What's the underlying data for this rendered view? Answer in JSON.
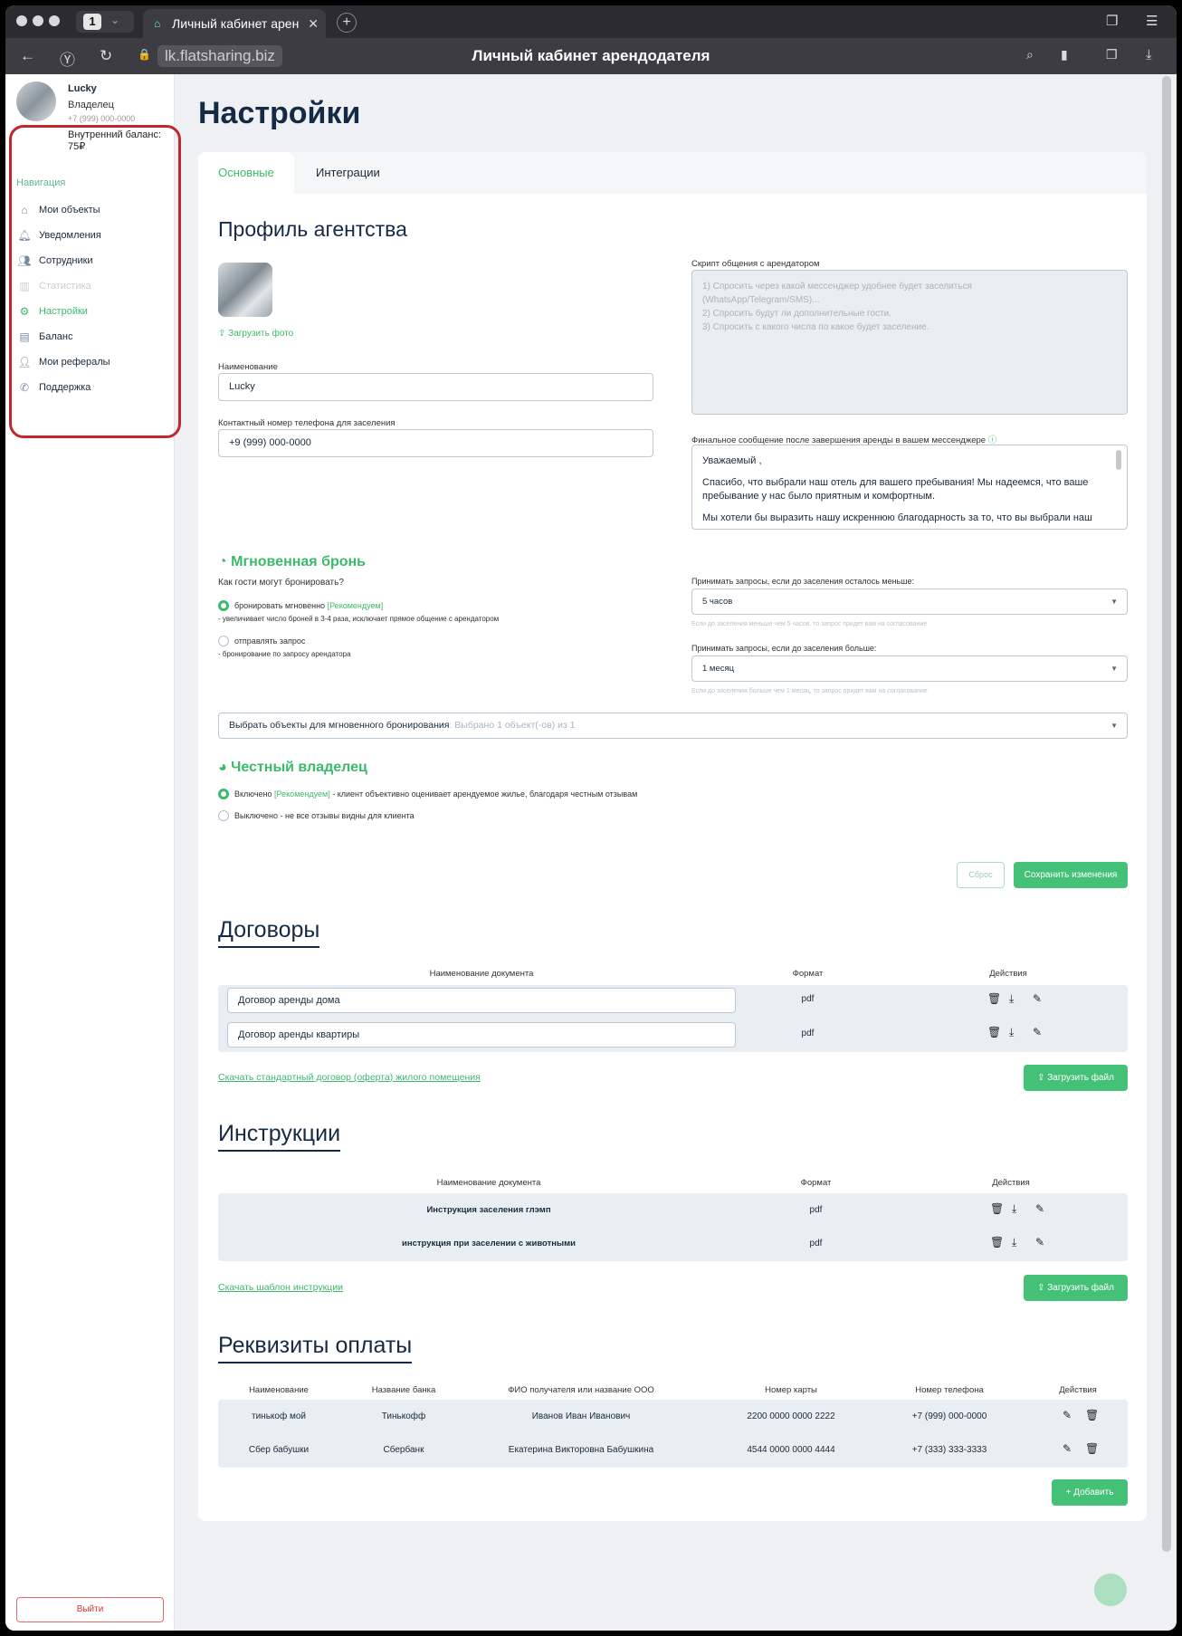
{
  "browser": {
    "tab_count": "1",
    "tab_title": "Личный кабинет арен",
    "url": "lk.flatsharing.biz",
    "page_title": "Личный кабинет арендодателя"
  },
  "sidebar": {
    "user_name": "Lucky",
    "user_role": "Владелец",
    "user_phone": "+7 (999) 000-0000",
    "balance_label": "Внутренний баланс:",
    "balance_value": "75₽",
    "nav_heading": "Навигация",
    "items": [
      {
        "label": "Мои объекты",
        "icon": "home-icon"
      },
      {
        "label": "Уведомления",
        "icon": "bell-icon"
      },
      {
        "label": "Сотрудники",
        "icon": "users-icon"
      },
      {
        "label": "Статистика",
        "icon": "chart-icon"
      },
      {
        "label": "Настройки",
        "icon": "gear-icon"
      },
      {
        "label": "Баланс",
        "icon": "wallet-icon"
      },
      {
        "label": "Мои рефералы",
        "icon": "referral-icon"
      },
      {
        "label": "Поддержка",
        "icon": "phone-icon"
      }
    ],
    "active_item": "Настройки",
    "logout_label": "Выйти"
  },
  "page": {
    "heading": "Настройки",
    "tabs": [
      "Основные",
      "Интеграции"
    ],
    "active_tab": "Основные"
  },
  "profile": {
    "heading": "Профиль агентства",
    "upload_photo": "Загрузить фото",
    "name_label": "Наименование",
    "name_value": "Lucky",
    "phone_label": "Контактный номер телефона для заселения",
    "phone_value": "+9 (999) 000-0000",
    "script_label": "Скрипт общения с арендатором",
    "script_lines": [
      "1) Спросить через какой мессенджер удобнее будет заселиться",
      "(WhatsApp/Telegram/SMS)...",
      "2) Спросить будут ли дополнительные гости.",
      "3) Спросить с какого числа по какое будет заселение."
    ],
    "final_msg_label": "Финальное сообщение после завершения аренды в вашем мессенджере",
    "final_msg_lines": [
      "Уважаемый ,",
      "",
      "Спасибо, что выбрали наш отель для вашего пребывания! Мы надеемся, что ваше",
      "пребывание у нас было приятным и комфортным.",
      "",
      "Мы хотели бы выразить нашу искреннюю благодарность за то, что вы выбрали наш"
    ]
  },
  "instant": {
    "heading": "Мгновенная бронь",
    "question": "Как гости могут бронировать?",
    "option1": "бронировать мгновенно",
    "option1_tag": "[Рекомендуем]",
    "option1_desc": "- увеличивает число броней в 3-4 раза, исключает прямое общение с арендатором",
    "option2": "отправлять запрос",
    "option2_desc": "- бронирование по запросу арендатора",
    "less_label": "Принимать запросы, если до заселения осталось меньше:",
    "less_value": "5 часов",
    "less_hint": "Если до заселения меньше чем 5 часов, то запрос придет вам на согласование",
    "more_label": "Принимать запросы, если до заселения больше:",
    "more_value": "1 месяц",
    "more_hint": "Если до заселения больше чем 1 месяц, то запрос придет вам на согласование",
    "objects_label": "Выбрать объекты для мгновенного бронирования",
    "objects_value": ": Выбрано 1 объект(-ов) из 1"
  },
  "honest": {
    "heading": "Честный владелец",
    "on_label": "Включено",
    "on_tag": "[Рекомендуем]",
    "on_desc": "- клиент объективно оценивает арендуемое жилье, благодаря честным отзывам",
    "off_label": "Выключено",
    "off_desc": "- не все отзывы видны для клиента"
  },
  "form_buttons": {
    "reset": "Сброс",
    "save": "Сохранить изменения"
  },
  "contracts": {
    "heading": "Договоры",
    "col_name": "Наименование документа",
    "col_format": "Формат",
    "col_actions": "Действия",
    "rows": [
      {
        "name": "Договор аренды дома",
        "format": "pdf"
      },
      {
        "name": "Договор аренды квартиры",
        "format": "pdf"
      }
    ],
    "download_link": "Скачать стандартный договор (оферта) жилого помещения",
    "upload": "Загрузить файл"
  },
  "instructions": {
    "heading": "Инструкции",
    "col_name": "Наименование документа",
    "col_format": "Формат",
    "col_actions": "Действия",
    "rows": [
      {
        "name": "Инструкция заселения глэмп",
        "format": "pdf"
      },
      {
        "name": "инструкция при заселении с животными",
        "format": "pdf"
      }
    ],
    "download_link": "Скачать шаблон инструкции",
    "upload": "Загрузить файл"
  },
  "payments": {
    "heading": "Реквизиты оплаты",
    "cols": [
      "Наименование",
      "Название банка",
      "ФИО получателя или название ООО",
      "Номер карты",
      "Номер телефона",
      "Действия"
    ],
    "rows": [
      [
        "тинькоф мой",
        "Тинькофф",
        "Иванов Иван Иванович",
        "2200 0000 0000 2222",
        "+7 (999) 000-0000"
      ],
      [
        "Сбер бабушки",
        "Сбербанк",
        "Екатерина Викторовна Бабушкина",
        "4544 0000 0000 4444",
        "+7 (333) 333-3333"
      ]
    ],
    "add": "Добавить"
  },
  "colors": {
    "accent": "#3db96b",
    "heading": "#152a44",
    "highlight": "#c0282d"
  }
}
